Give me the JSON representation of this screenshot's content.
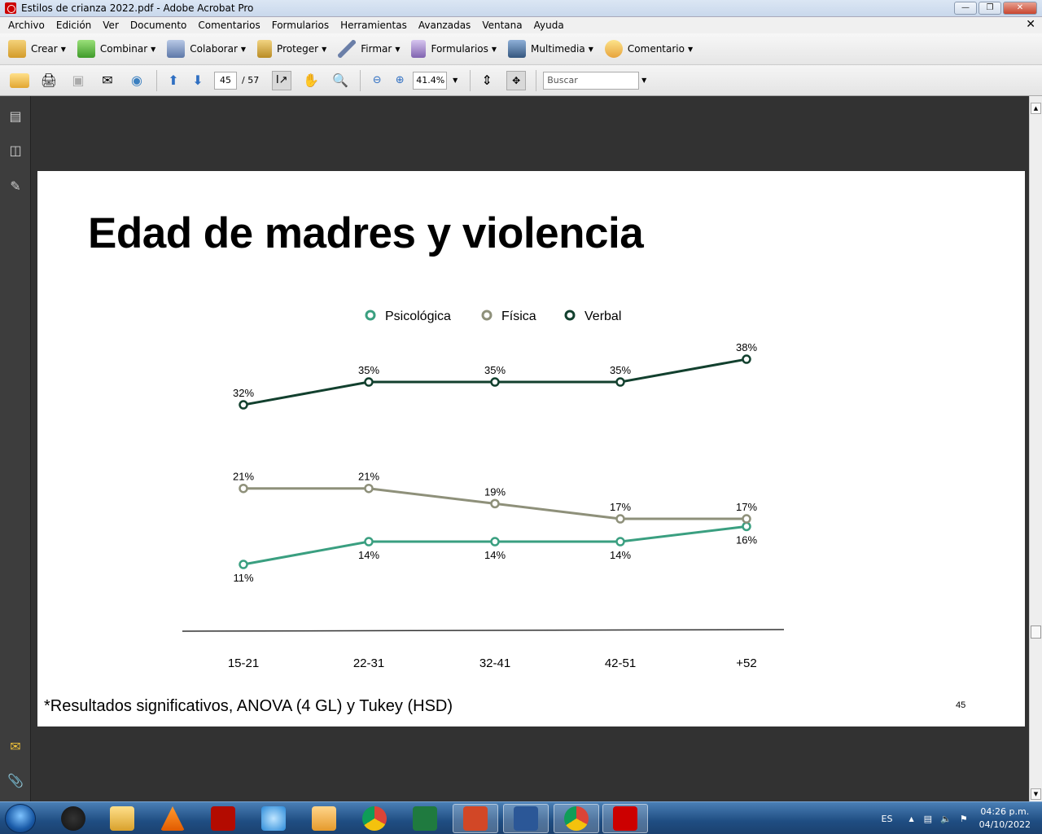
{
  "window": {
    "title": "Estilos de crianza 2022.pdf - Adobe Acrobat Pro"
  },
  "menu": {
    "items": [
      "Archivo",
      "Edición",
      "Ver",
      "Documento",
      "Comentarios",
      "Formularios",
      "Herramientas",
      "Avanzadas",
      "Ventana",
      "Ayuda"
    ]
  },
  "toolbar1": {
    "crear": "Crear",
    "combinar": "Combinar",
    "colaborar": "Colaborar",
    "proteger": "Proteger",
    "firmar": "Firmar",
    "formularios": "Formularios",
    "multimedia": "Multimedia",
    "comentario": "Comentario"
  },
  "toolbar2": {
    "page_current": "45",
    "page_total": "/ 57",
    "zoom": "41.4%",
    "search_placeholder": "Buscar"
  },
  "slide": {
    "title": "Edad de madres y violencia",
    "footnote": "*Resultados significativos, ANOVA (4 GL)  y Tukey (HSD)",
    "page_number": "45"
  },
  "chart_data": {
    "type": "line",
    "categories": [
      "15-21",
      "22-31",
      "32-41",
      "42-51",
      "+52"
    ],
    "series": [
      {
        "name": "Psicológica",
        "values": [
          11,
          14,
          14,
          14,
          16
        ],
        "labels": [
          "11%",
          "14%",
          "14%",
          "14%",
          "16%"
        ],
        "color": "#3a9f80"
      },
      {
        "name": "Física",
        "values": [
          21,
          21,
          19,
          17,
          17
        ],
        "labels": [
          "21%",
          "21%",
          "19%",
          "17%",
          "17%"
        ],
        "color": "#8e907a"
      },
      {
        "name": "Verbal",
        "values": [
          32,
          35,
          35,
          35,
          38
        ],
        "labels": [
          "32%",
          "35%",
          "35%",
          "35%",
          "38%"
        ],
        "color": "#12402e"
      }
    ],
    "legend_position": "top-center",
    "grid": false
  },
  "taskbar": {
    "lang": "ES",
    "time": "04:26 p.m.",
    "date": "04/10/2022"
  }
}
